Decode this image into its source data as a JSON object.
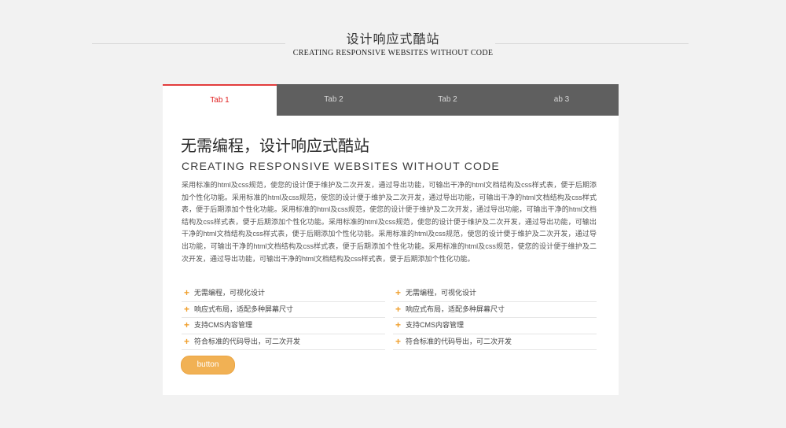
{
  "header": {
    "title": "设计响应式酷站",
    "subtitle": "CREATING RESPONSIVE WEBSITES WITHOUT CODE"
  },
  "tabs": [
    {
      "label": "Tab 1",
      "active": true
    },
    {
      "label": "Tab 2",
      "active": false
    },
    {
      "label": "Tab 2",
      "active": false
    },
    {
      "label": "ab 3",
      "active": false
    }
  ],
  "content": {
    "title": "无需编程，设计响应式酷站",
    "subtitle": "CREATING RESPONSIVE WEBSITES WITHOUT CODE",
    "body": "采用标准的html及css规范，使您的设计便于维护及二次开发，通过导出功能，可输出干净的html文档结构及css样式表，便于后期添加个性化功能。采用标准的html及css规范，使您的设计便于维护及二次开发，通过导出功能，可输出干净的html文档结构及css样式表，便于后期添加个性化功能。采用标准的html及css规范，使您的设计便于维护及二次开发，通过导出功能，可输出干净的html文档结构及css样式表，便于后期添加个性化功能。采用标准的html及css规范，使您的设计便于维护及二次开发，通过导出功能，可输出干净的html文档结构及css样式表，便于后期添加个性化功能。采用标准的html及css规范，使您的设计便于维护及二次开发，通过导出功能，可输出干净的html文档结构及css样式表，便于后期添加个性化功能。采用标准的html及css规范，使您的设计便于维护及二次开发，通过导出功能，可输出干净的html文档结构及css样式表，便于后期添加个性化功能。",
    "features_left": [
      "无需编程，可视化设计",
      "响应式布局，适配多种屏幕尺寸",
      "支持CMS内容管理",
      "符合标准的代码导出，可二次开发"
    ],
    "features_right": [
      "无需编程，可视化设计",
      "响应式布局，适配多种屏幕尺寸",
      "支持CMS内容管理",
      "符合标准的代码导出，可二次开发"
    ],
    "button_label": "button"
  },
  "colors": {
    "accent": "#e23c3c",
    "tab_bar": "#5f5f5f",
    "button": "#f1b154",
    "bullet": "#f0a02f"
  },
  "icons": {
    "bullet": "plus-icon"
  }
}
